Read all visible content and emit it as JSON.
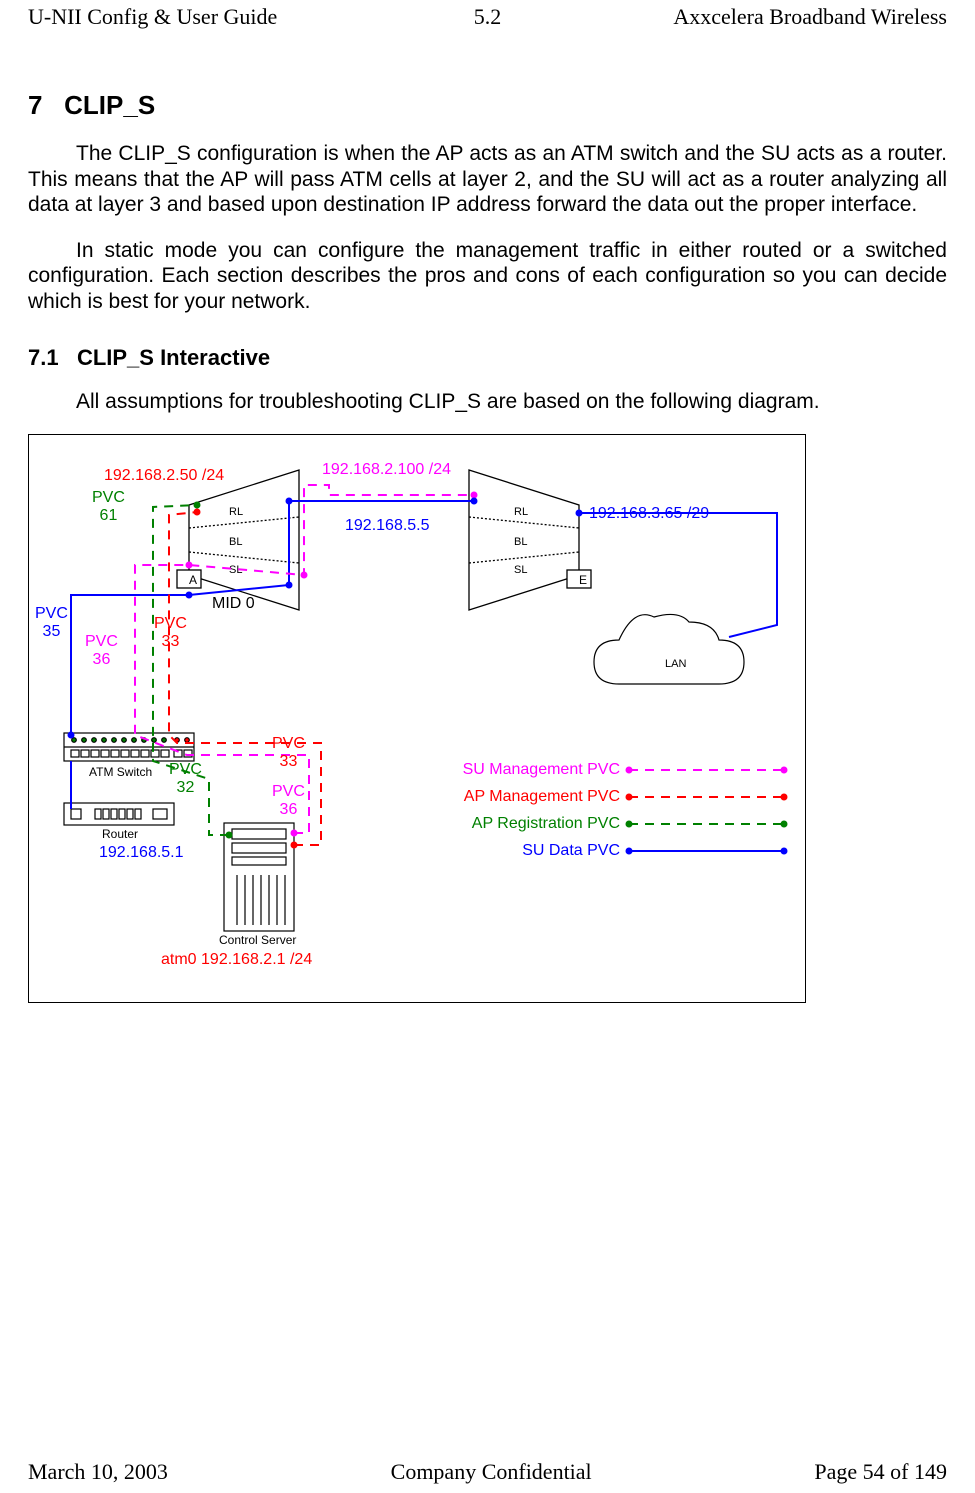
{
  "header": {
    "left": "U-NII Config & User Guide",
    "center": "5.2",
    "right": "Axxcelera Broadband Wireless"
  },
  "footer": {
    "left": "March 10, 2003",
    "center": "Company Confidential",
    "right": "Page 54 of 149"
  },
  "section": {
    "num": "7",
    "title": "CLIP_S"
  },
  "para1": "The CLIP_S configuration is when the AP acts as an ATM switch and the SU acts as a router. This means that the AP will pass ATM cells at layer 2, and the SU will act as a router analyzing all data at layer 3 and based upon destination IP address forward the data out the proper interface.",
  "para2": "In static mode you can configure the management traffic in either routed or a switched configuration. Each section describes the pros and cons of each configuration so you can decide which is best for your network.",
  "subsection": {
    "num": "7.1",
    "title": "CLIP_S Interactive"
  },
  "para3": "All assumptions for troubleshooting CLIP_S are based on the following diagram.",
  "diagram": {
    "ap": {
      "aLetter": "A",
      "rl": "RL",
      "bl": "BL",
      "sl": "SL",
      "mid": "MID 0",
      "mgmtIp": "192.168.2.50 /24",
      "dataIp": "192.168.5.5",
      "suMgmtIp": "192.168.2.100 /24"
    },
    "su": {
      "eLetter": "E",
      "rl": "RL",
      "bl": "BL",
      "sl": "SL",
      "ethIp": "192.168.3.65 /29"
    },
    "lan": "LAN",
    "atmswitch": "ATM Switch",
    "router": "Router",
    "routerIp": "192.168.5.1",
    "controlServer": "Control Server",
    "controlServerIp": "atm0 192.168.2.1 /24",
    "pvc": {
      "p61": "PVC\n61",
      "p35": "PVC\n35",
      "p36a": "PVC\n36",
      "p33a": "PVC\n33",
      "p32": "PVC\n32",
      "p33b": "PVC\n33",
      "p36b": "PVC\n36"
    },
    "legend": {
      "suMgmt": "SU Management PVC",
      "apMgmt": "AP Management PVC",
      "apReg": "AP Registration PVC",
      "suData": "SU Data PVC"
    },
    "colors": {
      "magenta": "#ff00ff",
      "red": "#ff0000",
      "green": "#008000",
      "blue": "#0000ff",
      "black": "#000000"
    }
  }
}
